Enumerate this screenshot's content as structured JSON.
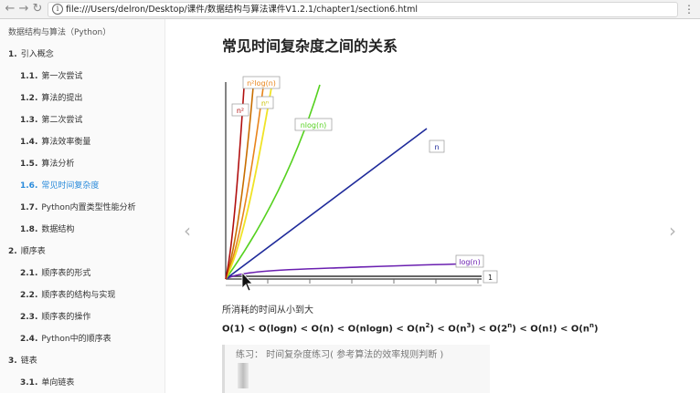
{
  "browser": {
    "url": "file:///Users/delron/Desktop/课件/数据结构与算法课件V1.2.1/chapter1/section6.html"
  },
  "sidebar": {
    "book_title": "数据结构与算法（Python）",
    "items": [
      {
        "num": "1.",
        "label": "引入概念",
        "level": 1
      },
      {
        "num": "1.1.",
        "label": "第一次尝试",
        "level": 2
      },
      {
        "num": "1.2.",
        "label": "算法的提出",
        "level": 2
      },
      {
        "num": "1.3.",
        "label": "第二次尝试",
        "level": 2
      },
      {
        "num": "1.4.",
        "label": "算法效率衡量",
        "level": 2
      },
      {
        "num": "1.5.",
        "label": "算法分析",
        "level": 2
      },
      {
        "num": "1.6.",
        "label": "常见时间复杂度",
        "level": 2,
        "active": true
      },
      {
        "num": "1.7.",
        "label": "Python内置类型性能分析",
        "level": 2
      },
      {
        "num": "1.8.",
        "label": "数据结构",
        "level": 2
      },
      {
        "num": "2.",
        "label": "顺序表",
        "level": 1
      },
      {
        "num": "2.1.",
        "label": "顺序表的形式",
        "level": 2
      },
      {
        "num": "2.2.",
        "label": "顺序表的结构与实现",
        "level": 2
      },
      {
        "num": "2.3.",
        "label": "顺序表的操作",
        "level": 2
      },
      {
        "num": "2.4.",
        "label": "Python中的顺序表",
        "level": 2
      },
      {
        "num": "3.",
        "label": "链表",
        "level": 1
      },
      {
        "num": "3.1.",
        "label": "单向链表",
        "level": 2
      }
    ]
  },
  "content": {
    "title": "常见时间复杂度之间的关系",
    "caption": "所消耗的时间从小到大",
    "formula": {
      "p1": "O(1) < O(logn) < O(n) < O(nlogn) < O(n",
      "s1": "2",
      "p2": ") < O(n",
      "s2": "3",
      "p3": ") < O(2",
      "s3": "n",
      "p4": ") < O(n!) < O(n",
      "s4": "n",
      "p5": ")"
    },
    "exercise": "练习：  时间复杂度练习( 参考算法的效率规则判断 )"
  },
  "chart_data": {
    "type": "line",
    "title": "",
    "xlabel": "",
    "ylabel": "",
    "series": [
      {
        "name": "1",
        "color": "#333333"
      },
      {
        "name": "log(n)",
        "color": "#6a1fb0"
      },
      {
        "name": "n",
        "color": "#1e2a9a"
      },
      {
        "name": "nlog(n)",
        "color": "#55d11f"
      },
      {
        "name": "n²",
        "color": "#f0e326"
      },
      {
        "name": "n³",
        "color": "#c86e00"
      },
      {
        "name": "nⁿ",
        "color": "#b11010"
      }
    ],
    "legend_labels": {
      "n_sq": "n²",
      "n_n": "nⁿ",
      "n2log": "n²log(n)",
      "n_cubed": "n³",
      "nlogn": "nlog(n)",
      "n": "n",
      "logn": "log(n)",
      "one": "1"
    },
    "extra_colors": {
      "n2log": "#e8841b",
      "n_sq": "#f0e326"
    }
  }
}
